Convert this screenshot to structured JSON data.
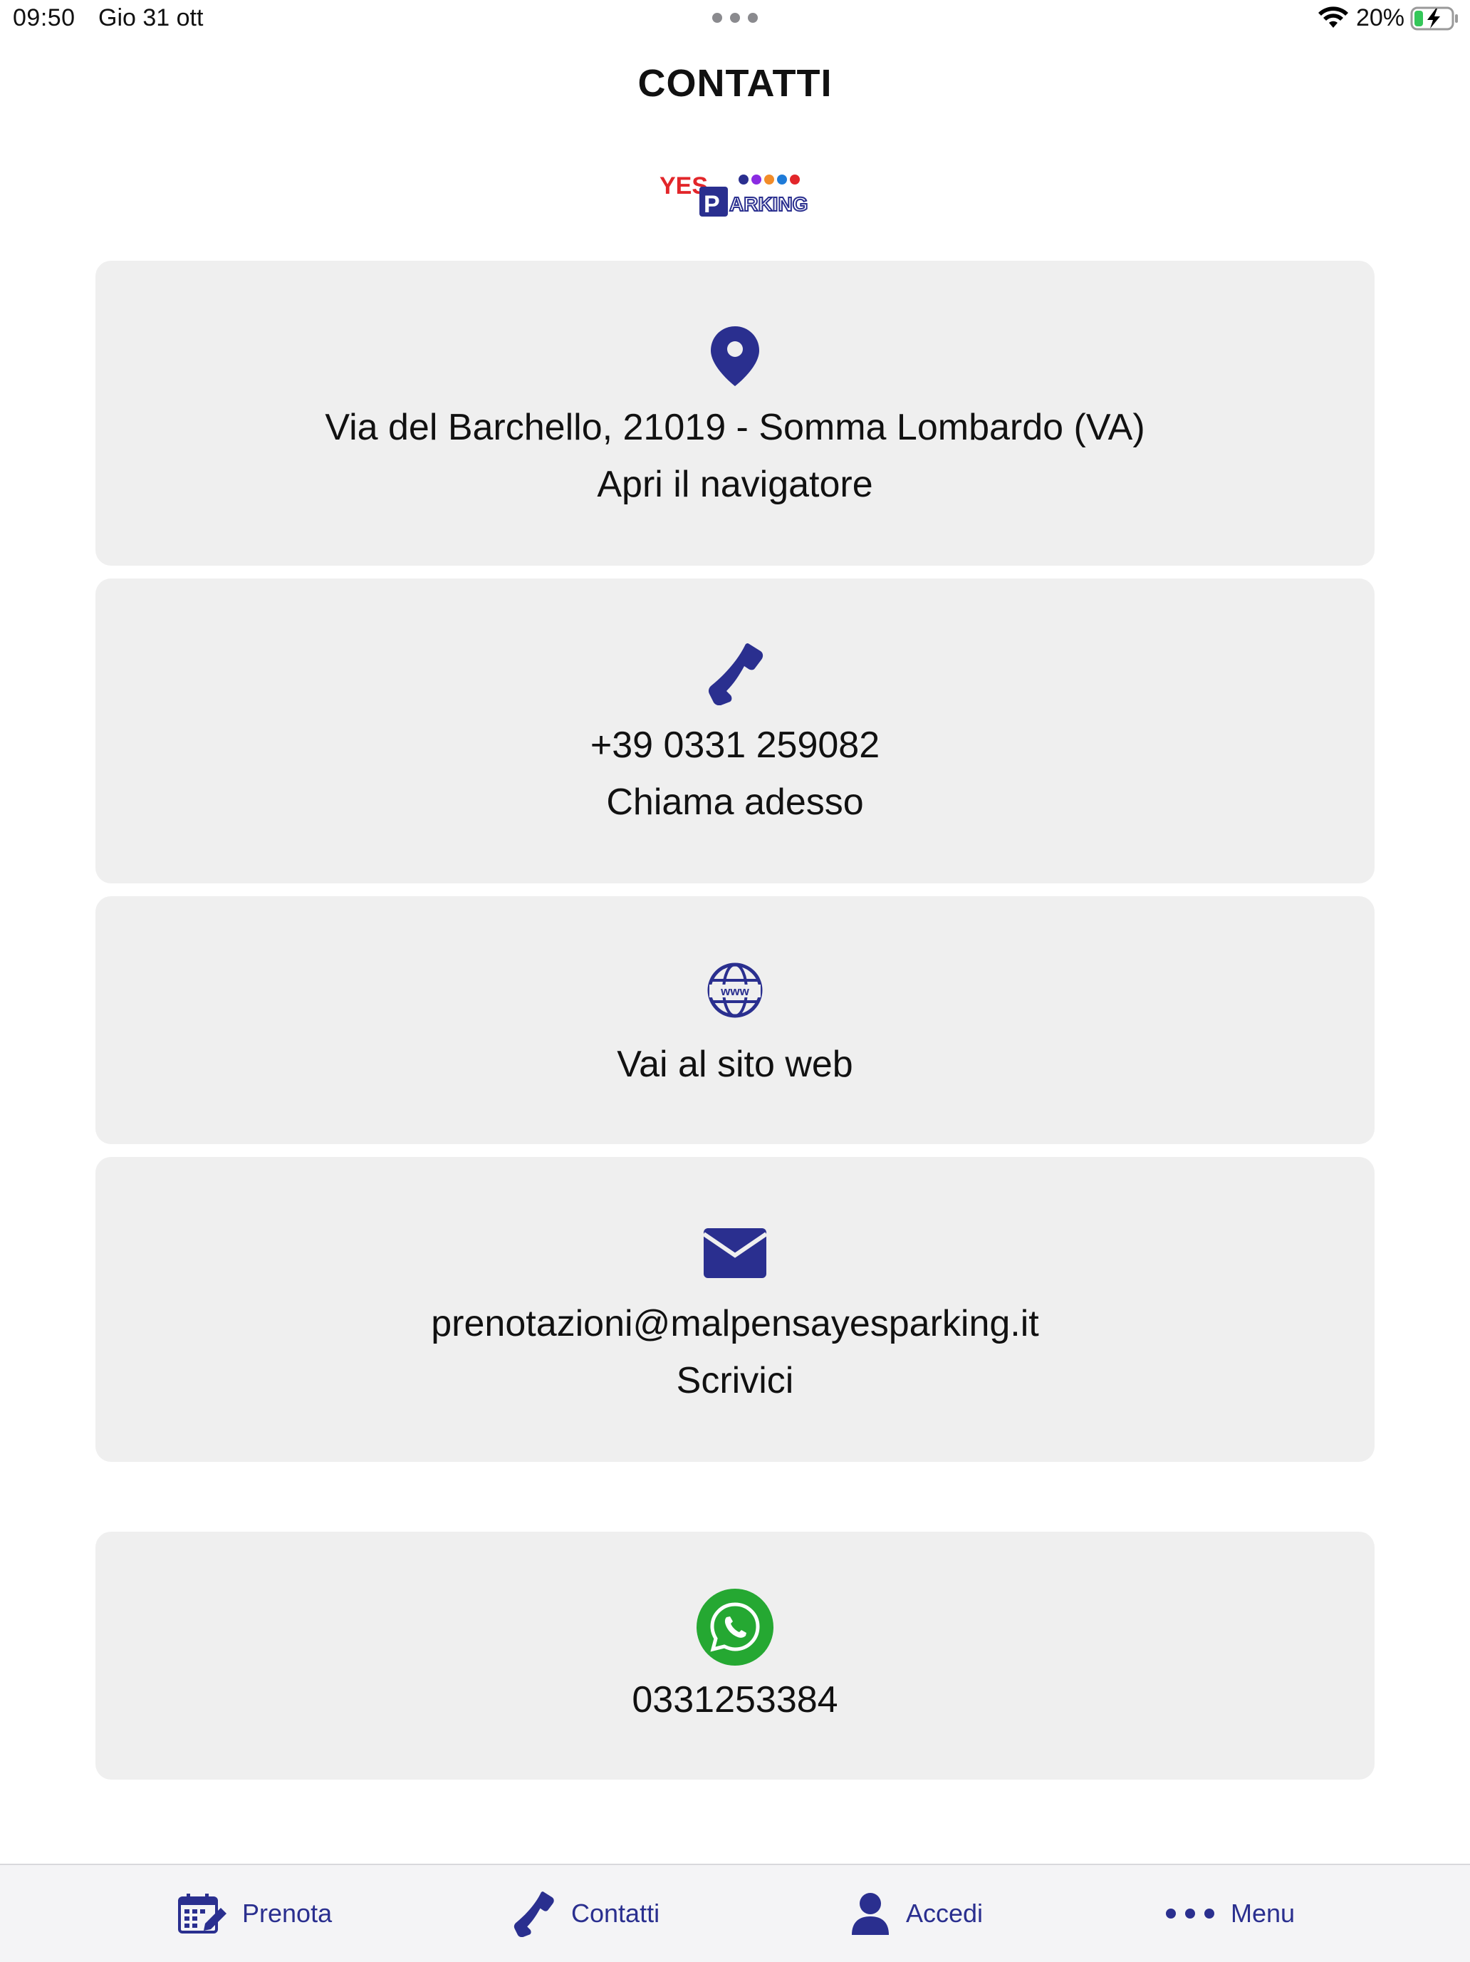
{
  "status_bar": {
    "time": "09:50",
    "date": "Gio 31 ott",
    "battery": "20%",
    "icons": [
      "wifi-icon",
      "battery-charging-icon"
    ]
  },
  "header": {
    "title": "CONTATTI",
    "logo_text": "YES PARKING"
  },
  "contacts": {
    "address": {
      "icon": "map-pin-icon",
      "line1": "Via del Barchello, 21019 - Somma Lombardo (VA)",
      "line2": "Apri il navigatore"
    },
    "phone": {
      "icon": "phone-icon",
      "line1": "+39 0331 259082",
      "line2": "Chiama adesso"
    },
    "web": {
      "icon": "globe-www-icon",
      "line1": "Vai al sito web"
    },
    "email": {
      "icon": "envelope-icon",
      "line1": "prenotazioni@malpensayesparking.it",
      "line2": "Scrivici"
    },
    "whatsapp": {
      "icon": "whatsapp-icon",
      "line1": "0331253384"
    }
  },
  "tab_bar": {
    "items": [
      {
        "label": "Prenota",
        "icon": "calendar-edit-icon"
      },
      {
        "label": "Contatti",
        "icon": "phone-icon"
      },
      {
        "label": "Accedi",
        "icon": "user-icon"
      },
      {
        "label": "Menu",
        "icon": "more-dots-icon"
      }
    ]
  },
  "colors": {
    "accent": "#2a2f8f",
    "card_bg": "#efefef",
    "whatsapp": "#25a832",
    "logo_red": "#e2262a"
  }
}
